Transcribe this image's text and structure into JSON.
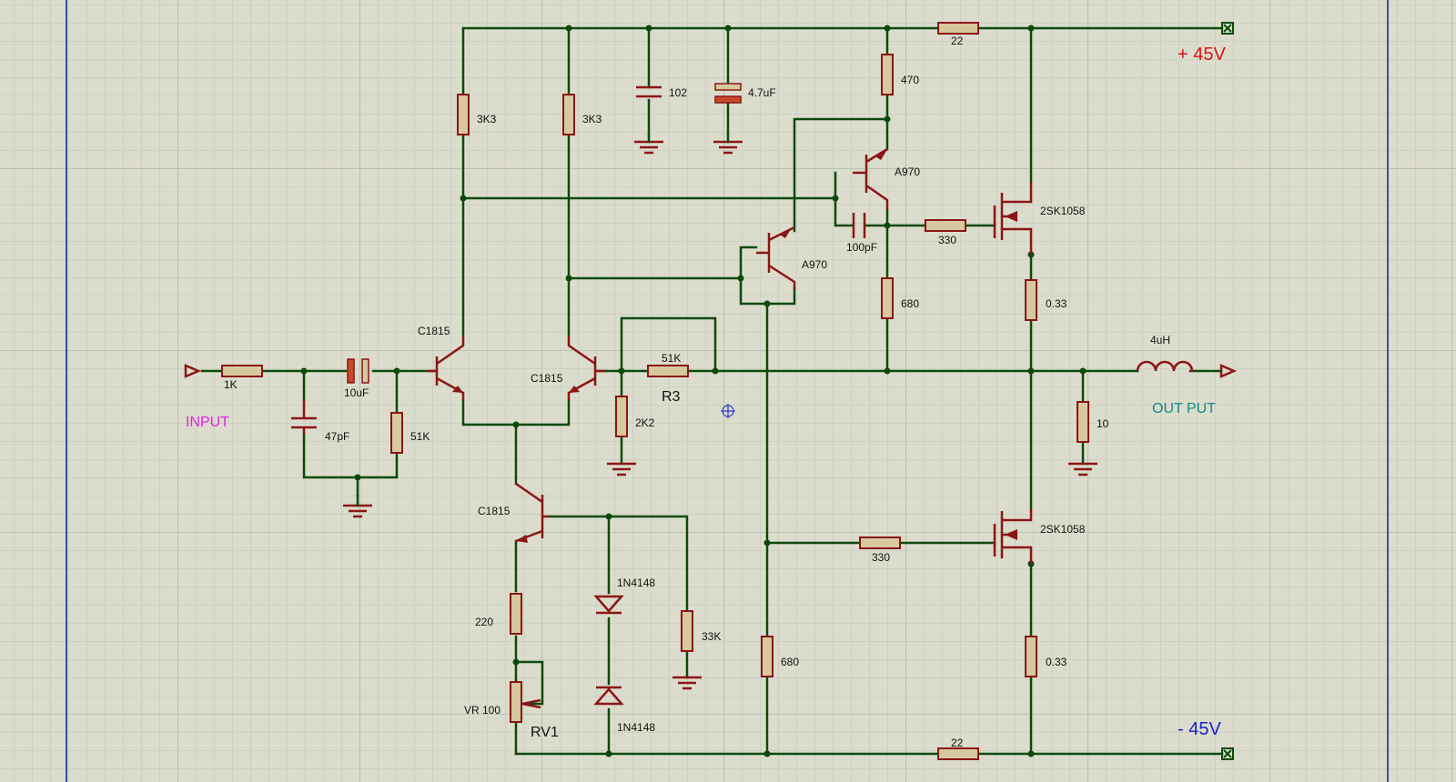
{
  "labels": {
    "v_pos": "+ 45V",
    "v_neg": "- 45V",
    "input": "INPUT",
    "output": "OUT PUT",
    "r_in": "1K",
    "c_in_filter": "47pF",
    "c_coupling": "10uF",
    "r_bias": "51K",
    "q1": "C1815",
    "q2": "C1815",
    "q3": "C1815",
    "r_load1": "3K3",
    "r_load2": "3K3",
    "c_decouple1": "102",
    "c_decouple2": "4.7uF",
    "r_fb": "51K",
    "r_fb_name": "R3",
    "r_fb_gnd": "2K2",
    "r_220": "220",
    "vr": "VR 100",
    "vr_name": "RV1",
    "d1": "1N4148",
    "d2": "1N4148",
    "r_33k": "33K",
    "q4": "A970",
    "q5": "A970",
    "c_100p": "100pF",
    "r_470": "470",
    "r_680_top": "680",
    "r_680_bot": "680",
    "r_330_top": "330",
    "r_330_bot": "330",
    "m1": "2SK1058",
    "m2": "2SK1058",
    "r_022_top": "0.33",
    "r_022_bot": "0.33",
    "r_22_top": "22",
    "r_22_bot": "22",
    "l_out": "4uH",
    "r_zobel": "10"
  },
  "colors": {
    "wire": "#0b4a0b",
    "component": "#8a1616",
    "v_pos": "#dd1111",
    "v_neg": "#1a22c8",
    "input": "#e020e0",
    "output": "#138a8a"
  }
}
